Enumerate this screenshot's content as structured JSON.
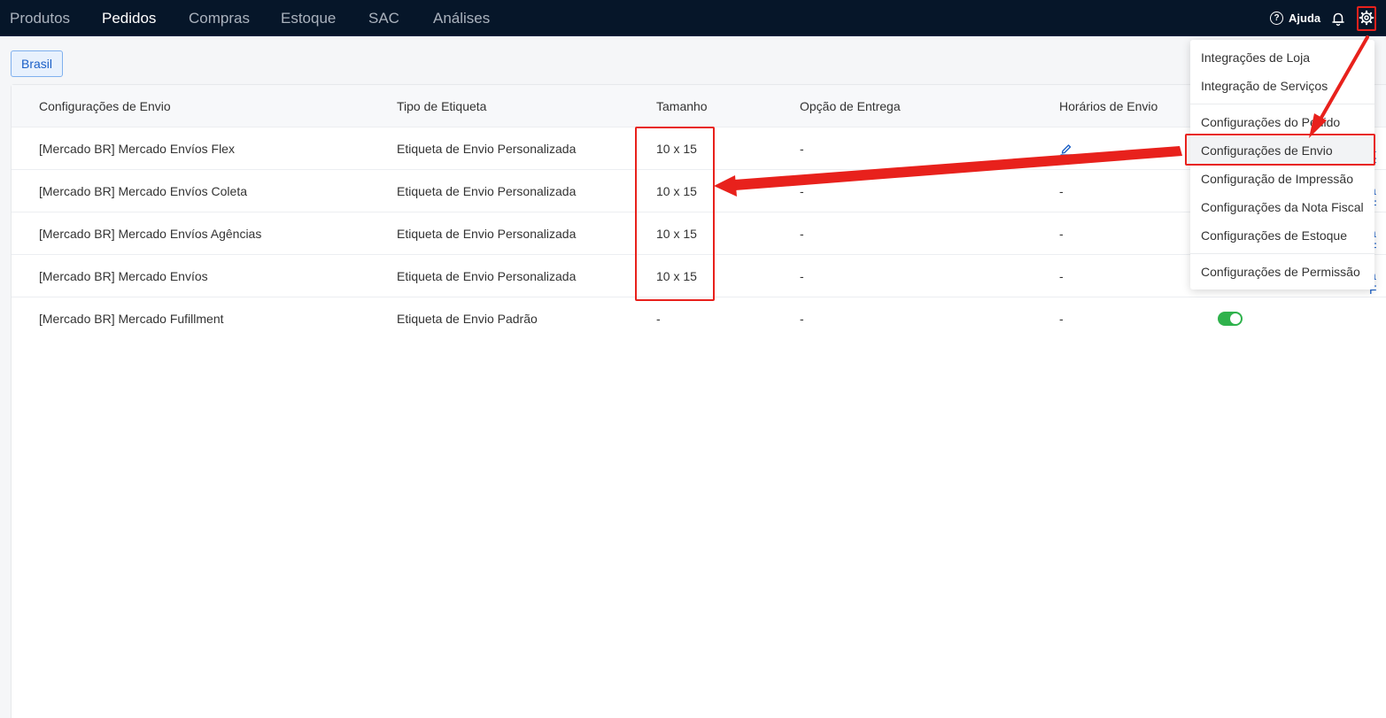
{
  "nav": {
    "items": [
      {
        "label": "Produtos"
      },
      {
        "label": "Pedidos"
      },
      {
        "label": "Compras"
      },
      {
        "label": "Estoque"
      },
      {
        "label": "SAC"
      },
      {
        "label": "Análises"
      }
    ],
    "active": "Pedidos",
    "help_label": "Ajuda",
    "help_icon": "?",
    "icons": [
      "help-circle-icon",
      "bell-icon",
      "gear-icon"
    ]
  },
  "region_tab": "Brasil",
  "table": {
    "columns": [
      "Configurações de Envio",
      "Tipo de Etiqueta",
      "Tamanho",
      "Opção de Entrega",
      "Horários de Envio"
    ],
    "rows": [
      {
        "name": "[Mercado BR] Mercado Envíos Flex",
        "label_type": "Etiqueta de Envio Personalizada",
        "size": "10 x 15",
        "delivery": "-",
        "schedule": "edit-icon"
      },
      {
        "name": "[Mercado BR] Mercado Envíos Coleta",
        "label_type": "Etiqueta de Envio Personalizada",
        "size": "10 x 15",
        "delivery": "-",
        "schedule": "-"
      },
      {
        "name": "[Mercado BR] Mercado Envíos Agências",
        "label_type": "Etiqueta de Envio Personalizada",
        "size": "10 x 15",
        "delivery": "-",
        "schedule": "-"
      },
      {
        "name": "[Mercado BR] Mercado Envíos",
        "label_type": "Etiqueta de Envio Personalizada",
        "size": "10 x 15",
        "delivery": "-",
        "schedule": "-"
      },
      {
        "name": "[Mercado BR] Mercado Fufillment",
        "label_type": "Etiqueta de Envio Padrão",
        "size": "-",
        "delivery": "-",
        "schedule": "-",
        "toggle_on": true
      }
    ],
    "partial_link_texts": [
      "a F",
      "a F",
      "a F",
      "a F"
    ]
  },
  "settings_menu": {
    "items": [
      "Integrações de Loja",
      "Integração de Serviços",
      "Configurações do Pedido",
      "Configurações de Envio",
      "Configuração de Impressão",
      "Configurações da Nota Fiscal",
      "Configurações de Estoque",
      "Configurações de Permissão"
    ],
    "selected": "Configurações de Envio"
  },
  "colors": {
    "topbar": "#061629",
    "accent": "#1a5fc7",
    "annotation": "#e8211c",
    "toggle_on": "#2fb24c"
  }
}
